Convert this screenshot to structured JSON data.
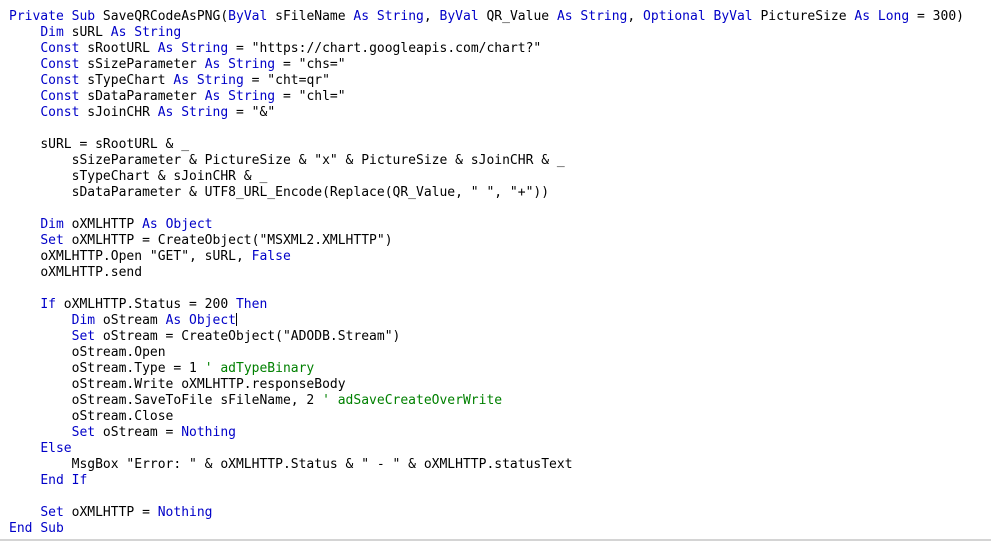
{
  "editor": {
    "language": "VBA",
    "background_color": "#ffffff",
    "keyword_color": "#0000C8",
    "comment_color": "#008000",
    "text_color": "#000000",
    "caret_line_index": 21,
    "caret_after_text": "Object"
  },
  "code": {
    "lines": [
      {
        "indent": 0,
        "tokens": [
          {
            "t": "Private",
            "c": "kw"
          },
          {
            "t": " ",
            "c": "id"
          },
          {
            "t": "Sub",
            "c": "kw"
          },
          {
            "t": " SaveQRCodeAsPNG(",
            "c": "id"
          },
          {
            "t": "ByVal",
            "c": "kw"
          },
          {
            "t": " sFileName ",
            "c": "id"
          },
          {
            "t": "As",
            "c": "kw"
          },
          {
            "t": " ",
            "c": "id"
          },
          {
            "t": "String",
            "c": "kw"
          },
          {
            "t": ", ",
            "c": "id"
          },
          {
            "t": "ByVal",
            "c": "kw"
          },
          {
            "t": " QR_Value ",
            "c": "id"
          },
          {
            "t": "As",
            "c": "kw"
          },
          {
            "t": " ",
            "c": "id"
          },
          {
            "t": "String",
            "c": "kw"
          },
          {
            "t": ", ",
            "c": "id"
          },
          {
            "t": "Optional",
            "c": "kw"
          },
          {
            "t": " ",
            "c": "id"
          },
          {
            "t": "ByVal",
            "c": "kw"
          },
          {
            "t": " PictureSize ",
            "c": "id"
          },
          {
            "t": "As",
            "c": "kw"
          },
          {
            "t": " ",
            "c": "id"
          },
          {
            "t": "Long",
            "c": "kw"
          },
          {
            "t": " = 300)",
            "c": "id"
          }
        ]
      },
      {
        "indent": 1,
        "tokens": [
          {
            "t": "Dim",
            "c": "kw"
          },
          {
            "t": " sURL ",
            "c": "id"
          },
          {
            "t": "As",
            "c": "kw"
          },
          {
            "t": " ",
            "c": "id"
          },
          {
            "t": "String",
            "c": "kw"
          }
        ]
      },
      {
        "indent": 1,
        "tokens": [
          {
            "t": "Const",
            "c": "kw"
          },
          {
            "t": " sRootURL ",
            "c": "id"
          },
          {
            "t": "As",
            "c": "kw"
          },
          {
            "t": " ",
            "c": "id"
          },
          {
            "t": "String",
            "c": "kw"
          },
          {
            "t": " = \"https://chart.googleapis.com/chart?\"",
            "c": "id"
          }
        ]
      },
      {
        "indent": 1,
        "tokens": [
          {
            "t": "Const",
            "c": "kw"
          },
          {
            "t": " sSizeParameter ",
            "c": "id"
          },
          {
            "t": "As",
            "c": "kw"
          },
          {
            "t": " ",
            "c": "id"
          },
          {
            "t": "String",
            "c": "kw"
          },
          {
            "t": " = \"chs=\"",
            "c": "id"
          }
        ]
      },
      {
        "indent": 1,
        "tokens": [
          {
            "t": "Const",
            "c": "kw"
          },
          {
            "t": " sTypeChart ",
            "c": "id"
          },
          {
            "t": "As",
            "c": "kw"
          },
          {
            "t": " ",
            "c": "id"
          },
          {
            "t": "String",
            "c": "kw"
          },
          {
            "t": " = \"cht=qr\"",
            "c": "id"
          }
        ]
      },
      {
        "indent": 1,
        "tokens": [
          {
            "t": "Const",
            "c": "kw"
          },
          {
            "t": " sDataParameter ",
            "c": "id"
          },
          {
            "t": "As",
            "c": "kw"
          },
          {
            "t": " ",
            "c": "id"
          },
          {
            "t": "String",
            "c": "kw"
          },
          {
            "t": " = \"chl=\"",
            "c": "id"
          }
        ]
      },
      {
        "indent": 1,
        "tokens": [
          {
            "t": "Const",
            "c": "kw"
          },
          {
            "t": " sJoinCHR ",
            "c": "id"
          },
          {
            "t": "As",
            "c": "kw"
          },
          {
            "t": " ",
            "c": "id"
          },
          {
            "t": "String",
            "c": "kw"
          },
          {
            "t": " = \"&\"",
            "c": "id"
          }
        ]
      },
      {
        "indent": 0,
        "tokens": []
      },
      {
        "indent": 1,
        "tokens": [
          {
            "t": "sURL = sRootURL & _",
            "c": "id"
          }
        ]
      },
      {
        "indent": 2,
        "tokens": [
          {
            "t": "sSizeParameter & PictureSize & \"x\" & PictureSize & sJoinCHR & _",
            "c": "id"
          }
        ]
      },
      {
        "indent": 2,
        "tokens": [
          {
            "t": "sTypeChart & sJoinCHR & _",
            "c": "id"
          }
        ]
      },
      {
        "indent": 2,
        "tokens": [
          {
            "t": "sDataParameter & UTF8_URL_Encode(Replace(QR_Value, \" \", \"+\"))",
            "c": "id"
          }
        ]
      },
      {
        "indent": 0,
        "tokens": []
      },
      {
        "indent": 1,
        "tokens": [
          {
            "t": "Dim",
            "c": "kw"
          },
          {
            "t": " oXMLHTTP ",
            "c": "id"
          },
          {
            "t": "As",
            "c": "kw"
          },
          {
            "t": " ",
            "c": "id"
          },
          {
            "t": "Object",
            "c": "kw"
          }
        ]
      },
      {
        "indent": 1,
        "tokens": [
          {
            "t": "Set",
            "c": "kw"
          },
          {
            "t": " oXMLHTTP = CreateObject(\"MSXML2.XMLHTTP\")",
            "c": "id"
          }
        ]
      },
      {
        "indent": 1,
        "tokens": [
          {
            "t": "oXMLHTTP.Open \"GET\", sURL, ",
            "c": "id"
          },
          {
            "t": "False",
            "c": "kw"
          }
        ]
      },
      {
        "indent": 1,
        "tokens": [
          {
            "t": "oXMLHTTP.send",
            "c": "id"
          }
        ]
      },
      {
        "indent": 0,
        "tokens": []
      },
      {
        "indent": 1,
        "tokens": [
          {
            "t": "If",
            "c": "kw"
          },
          {
            "t": " oXMLHTTP.Status = 200 ",
            "c": "id"
          },
          {
            "t": "Then",
            "c": "kw"
          }
        ]
      },
      {
        "indent": 2,
        "tokens": [
          {
            "t": "Dim",
            "c": "kw"
          },
          {
            "t": " oStream ",
            "c": "id"
          },
          {
            "t": "As",
            "c": "kw"
          },
          {
            "t": " ",
            "c": "id"
          },
          {
            "t": "Object",
            "c": "kw"
          }
        ],
        "caret": true
      },
      {
        "indent": 2,
        "tokens": [
          {
            "t": "Set",
            "c": "kw"
          },
          {
            "t": " oStream = CreateObject(\"ADODB.Stream\")",
            "c": "id"
          }
        ]
      },
      {
        "indent": 2,
        "tokens": [
          {
            "t": "oStream.Open",
            "c": "id"
          }
        ]
      },
      {
        "indent": 2,
        "tokens": [
          {
            "t": "oStream.Type = 1 ",
            "c": "id"
          },
          {
            "t": "' adTypeBinary",
            "c": "cmt"
          }
        ]
      },
      {
        "indent": 2,
        "tokens": [
          {
            "t": "oStream.Write oXMLHTTP.responseBody",
            "c": "id"
          }
        ]
      },
      {
        "indent": 2,
        "tokens": [
          {
            "t": "oStream.SaveToFile sFileName, 2 ",
            "c": "id"
          },
          {
            "t": "' adSaveCreateOverWrite",
            "c": "cmt"
          }
        ]
      },
      {
        "indent": 2,
        "tokens": [
          {
            "t": "oStream.Close",
            "c": "id"
          }
        ]
      },
      {
        "indent": 2,
        "tokens": [
          {
            "t": "Set",
            "c": "kw"
          },
          {
            "t": " oStream = ",
            "c": "id"
          },
          {
            "t": "Nothing",
            "c": "kw"
          }
        ]
      },
      {
        "indent": 1,
        "tokens": [
          {
            "t": "Else",
            "c": "kw"
          }
        ]
      },
      {
        "indent": 2,
        "tokens": [
          {
            "t": "MsgBox \"Error: \" & oXMLHTTP.Status & \" - \" & oXMLHTTP.statusText",
            "c": "id"
          }
        ]
      },
      {
        "indent": 1,
        "tokens": [
          {
            "t": "End",
            "c": "kw"
          },
          {
            "t": " ",
            "c": "id"
          },
          {
            "t": "If",
            "c": "kw"
          }
        ]
      },
      {
        "indent": 0,
        "tokens": []
      },
      {
        "indent": 1,
        "tokens": [
          {
            "t": "Set",
            "c": "kw"
          },
          {
            "t": " oXMLHTTP = ",
            "c": "id"
          },
          {
            "t": "Nothing",
            "c": "kw"
          }
        ]
      },
      {
        "indent": 0,
        "tokens": [
          {
            "t": "End",
            "c": "kw"
          },
          {
            "t": " ",
            "c": "id"
          },
          {
            "t": "Sub",
            "c": "kw"
          }
        ]
      }
    ]
  }
}
